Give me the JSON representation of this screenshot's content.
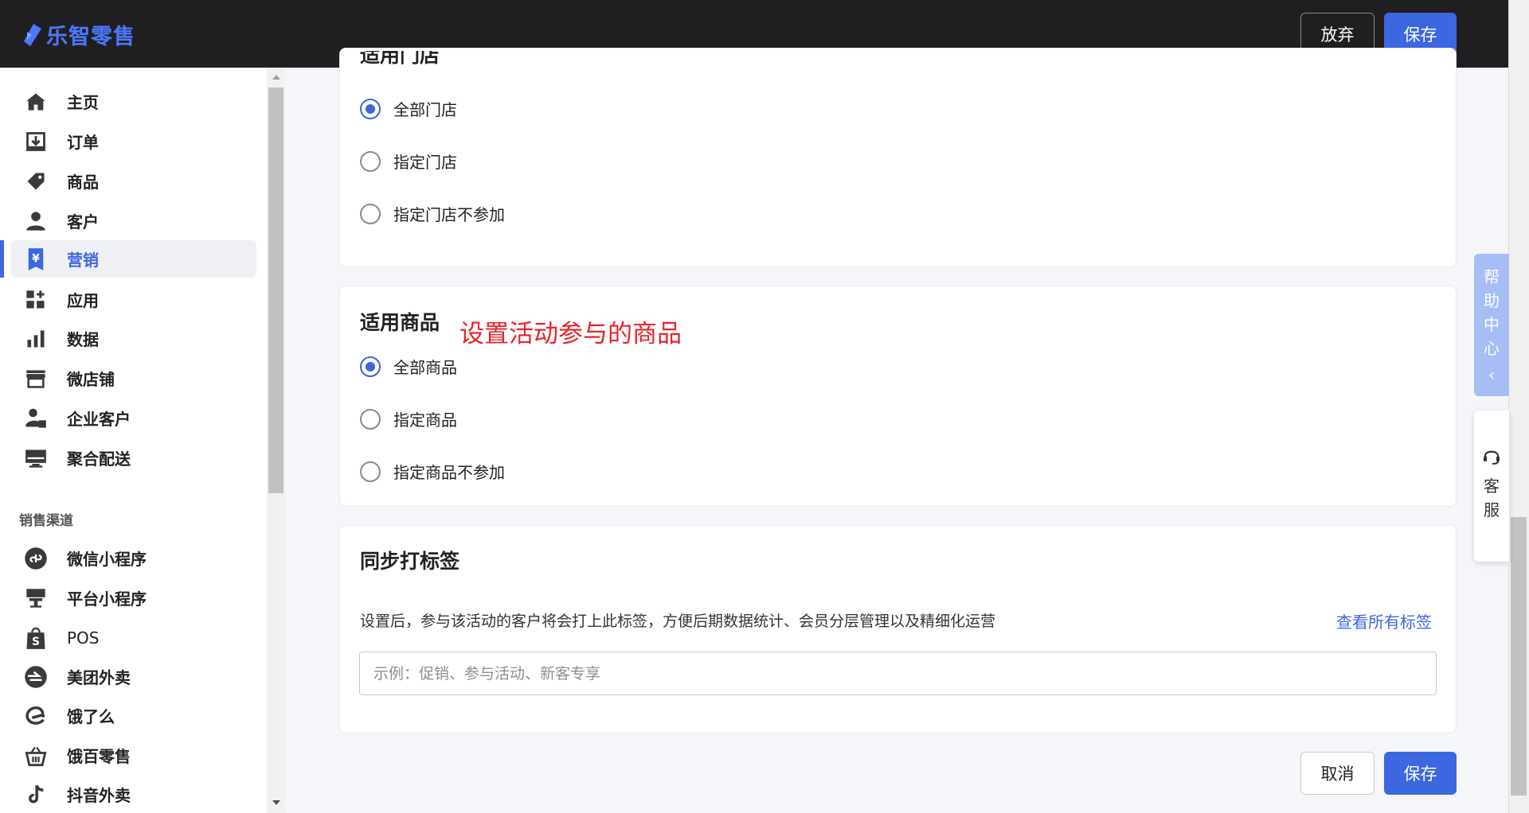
{
  "header": {
    "logo_text": "乐智零售",
    "abandon_label": "放弃",
    "save_label": "保存"
  },
  "sidebar": {
    "items": [
      {
        "label": "主页",
        "icon": "home-icon"
      },
      {
        "label": "订单",
        "icon": "order-download-icon"
      },
      {
        "label": "商品",
        "icon": "tag-icon"
      },
      {
        "label": "客户",
        "icon": "person-icon"
      },
      {
        "label": "营销",
        "icon": "marketing-yen-icon",
        "active": true
      },
      {
        "label": "应用",
        "icon": "apps-grid-icon"
      },
      {
        "label": "数据",
        "icon": "bar-chart-icon"
      },
      {
        "label": "微店铺",
        "icon": "storefront-icon"
      },
      {
        "label": "企业客户",
        "icon": "enterprise-user-icon"
      },
      {
        "label": "聚合配送",
        "icon": "monitor-icon"
      }
    ],
    "section_title": "销售渠道",
    "channels": [
      {
        "label": "微信小程序",
        "icon": "wechat-miniprogram-icon"
      },
      {
        "label": "平台小程序",
        "icon": "platform-miniprogram-icon"
      },
      {
        "label": "POS",
        "icon": "shopping-bag-icon"
      },
      {
        "label": "美团外卖",
        "icon": "meituan-icon"
      },
      {
        "label": "饿了么",
        "icon": "eleme-icon"
      },
      {
        "label": "饿百零售",
        "icon": "basket-icon"
      },
      {
        "label": "抖音外卖",
        "icon": "tiktok-icon"
      }
    ]
  },
  "store_section": {
    "title": "适用门店",
    "options": [
      "全部门店",
      "指定门店",
      "指定门店不参加"
    ],
    "selected_index": 0
  },
  "product_section": {
    "title": "适用商品",
    "annotation": "设置活动参与的商品",
    "options": [
      "全部商品",
      "指定商品",
      "指定商品不参加"
    ],
    "selected_index": 0
  },
  "tag_section": {
    "title": "同步打标签",
    "description": "设置后，参与该活动的客户将会打上此标签，方便后期数据统计、会员分层管理以及精细化运营",
    "view_all_link": "查看所有标签",
    "input_placeholder": "示例：促销、参与活动、新客专享",
    "input_value": ""
  },
  "footer": {
    "cancel_label": "取消",
    "save_label": "保存"
  },
  "floating": {
    "help_label": "帮助中心",
    "service_label": "客服"
  },
  "colors": {
    "accent": "#3d67e0",
    "topbar": "#1f1f21",
    "annotation": "#e8242b",
    "help_tab": "#a6bdf5"
  }
}
